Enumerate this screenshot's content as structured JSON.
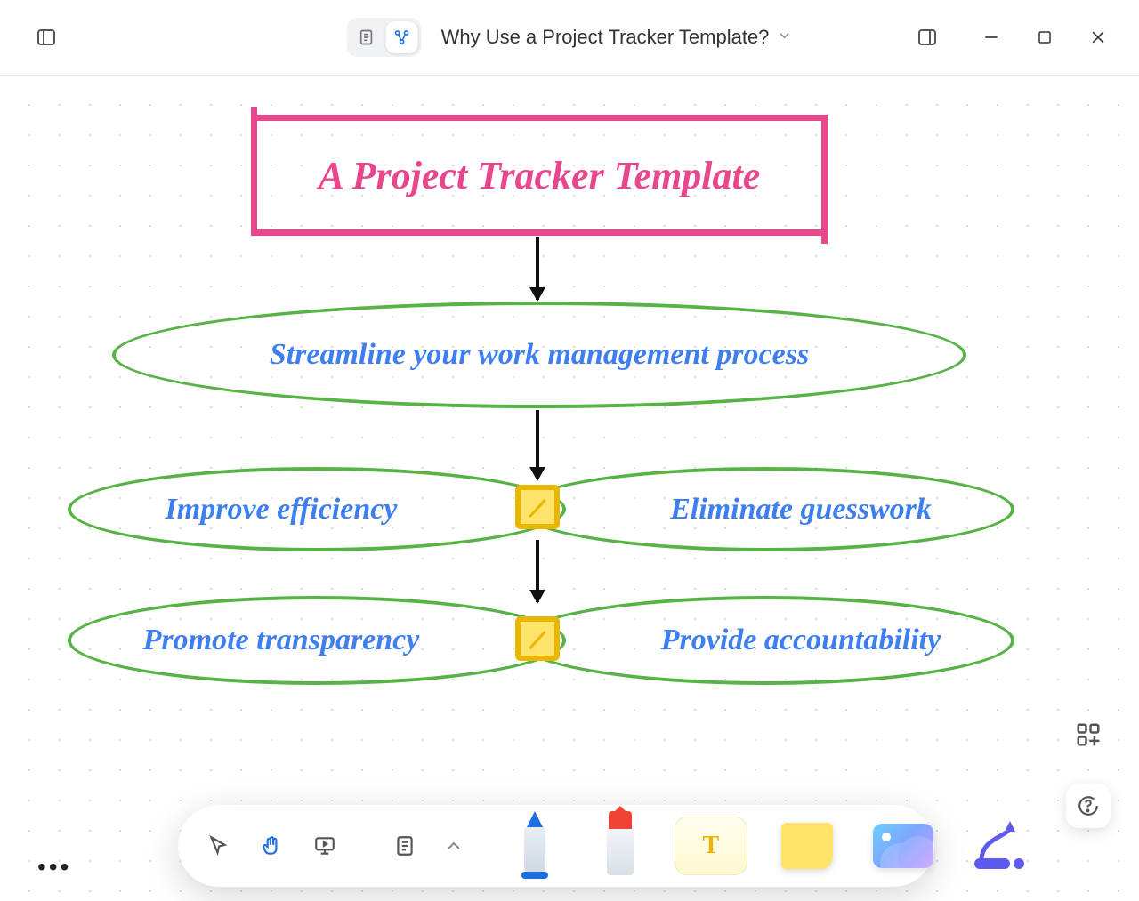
{
  "header": {
    "doc_title": "Why Use a Project Tracker Template?"
  },
  "diagram": {
    "title": "A Project Tracker Template",
    "nodes": {
      "streamline": "Streamline your work management process",
      "efficiency": "Improve efficiency",
      "eliminate": "Eliminate guesswork",
      "transparency": "Promote transparency",
      "accountability": "Provide accountability"
    }
  },
  "icons": {
    "sidebar": "sidebar-toggle",
    "outline_mode": "outline-mode",
    "mindmap_mode": "mindmap-mode",
    "split_view": "split-view",
    "minimize": "minimize",
    "maximize": "maximize",
    "close": "close",
    "pointer": "pointer",
    "hand": "hand",
    "present": "present",
    "note_outline": "note-outline",
    "pen": "pen",
    "eraser": "eraser",
    "text": "text",
    "sticky": "sticky-note",
    "image": "image",
    "connector": "connector",
    "shapes_add": "shapes-add",
    "help": "help",
    "more": "more"
  }
}
